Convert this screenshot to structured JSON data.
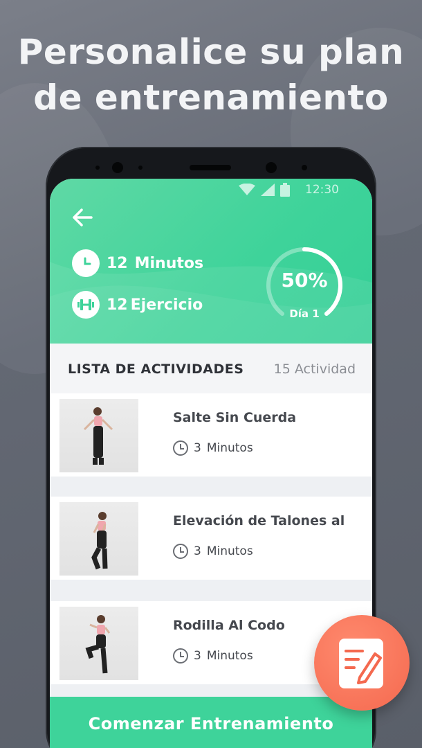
{
  "headline": {
    "line1": "Personalice su plan",
    "line2": "de entrenamiento"
  },
  "status_bar": {
    "time": "12:30"
  },
  "summary": {
    "minutes_value": "12",
    "minutes_label": "Minutos",
    "exercises_value": "12",
    "exercises_label": "Ejercicio",
    "progress_percent": "50%",
    "progress_fraction": 0.5,
    "day_label": "Día 1"
  },
  "activities": {
    "header_title": "LISTA DE ACTIVIDADES",
    "header_count": "15 Actividad",
    "items": [
      {
        "title": "Salte Sin Cuerda",
        "duration_value": "3",
        "duration_unit": "Minutos"
      },
      {
        "title": "Elevación de Talones al",
        "duration_value": "3",
        "duration_unit": "Minutos"
      },
      {
        "title": "Rodilla Al Codo",
        "duration_value": "3",
        "duration_unit": "Minutos"
      }
    ]
  },
  "start_button": {
    "label": "Comenzar Entrenamiento"
  },
  "colors": {
    "accent": "#3ed39a",
    "fab": "#f4694f",
    "background": "#636873"
  },
  "icons": {
    "back": "arrow-left-icon",
    "clock": "clock-icon",
    "dumbbell": "dumbbell-icon",
    "fab": "edit-plan-icon",
    "wifi": "wifi-icon",
    "signal": "signal-icon",
    "battery": "battery-icon"
  }
}
